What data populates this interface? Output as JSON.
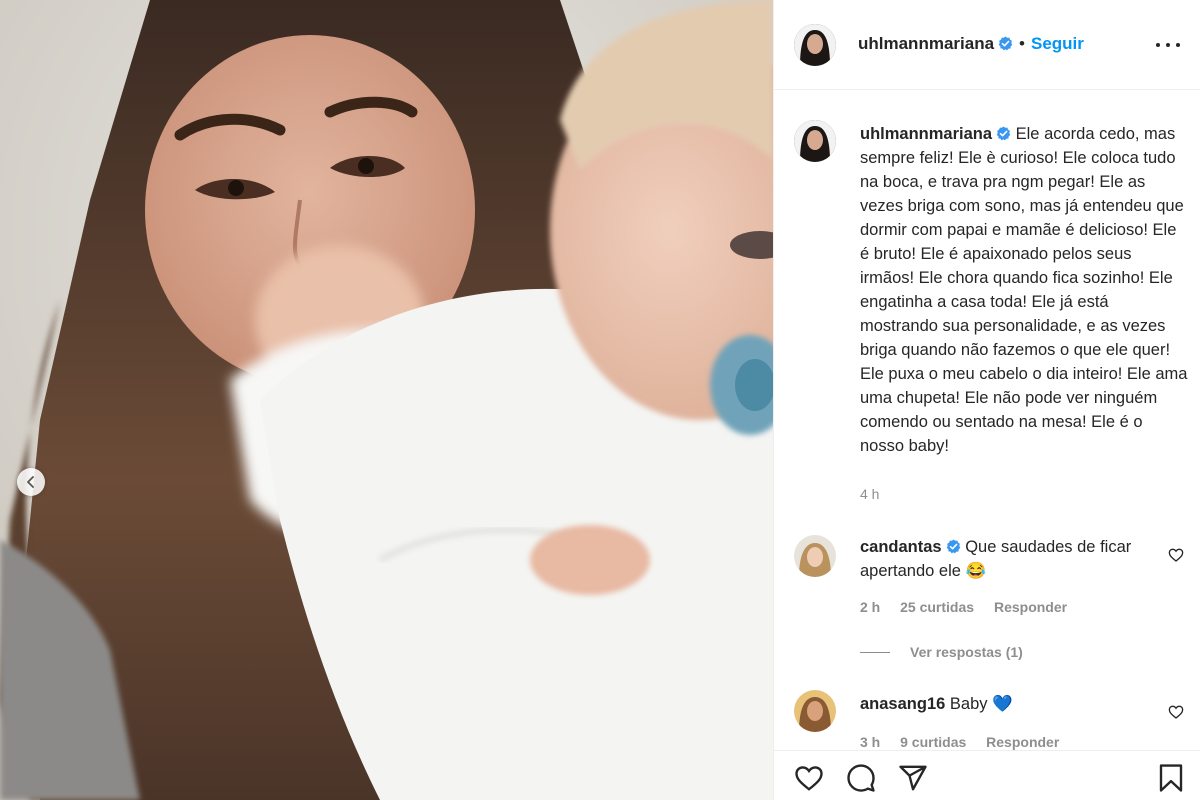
{
  "post": {
    "username": "uhlmannmariana",
    "follow_label": "Seguir",
    "separator": "•",
    "caption": "Ele acorda cedo, mas sempre feliz! Ele è curioso! Ele coloca tudo na boca, e trava pra ngm pegar! Ele as vezes briga com sono, mas já entendeu que dormir com papai e mamãe é delicioso! Ele é bruto! Ele é apaixonado pelos seus irmãos! Ele chora quando fica sozinho! Ele engatinha a casa toda! Ele já está mostrando sua personalidade, e as vezes briga quando não fazemos o que ele quer! Ele puxa o meu cabelo o dia inteiro! Ele ama uma chupeta! Ele não pode ver ninguém comendo ou sentado na mesa! Ele é o nosso baby!",
    "time_ago": "4 h"
  },
  "comments": [
    {
      "username": "candantas",
      "text": "Que saudades de ficar apertando ele 😂",
      "time": "2 h",
      "likes": "25 curtidas",
      "reply_label": "Responder",
      "view_replies": "Ver respostas (1)"
    },
    {
      "username": "anasang16",
      "text": "Baby 💙",
      "time": "3 h",
      "likes": "9 curtidas",
      "reply_label": "Responder"
    }
  ],
  "icons": {
    "more": "more-options-icon",
    "verified": "verified-badge-icon",
    "like": "heart-icon",
    "comment": "comment-icon",
    "share": "share-icon",
    "save": "bookmark-icon",
    "carousel_prev": "chevron-left-icon"
  },
  "colors": {
    "accent": "#0095f6",
    "text": "#262626",
    "muted": "#8e8e8e",
    "border": "#efefef"
  }
}
